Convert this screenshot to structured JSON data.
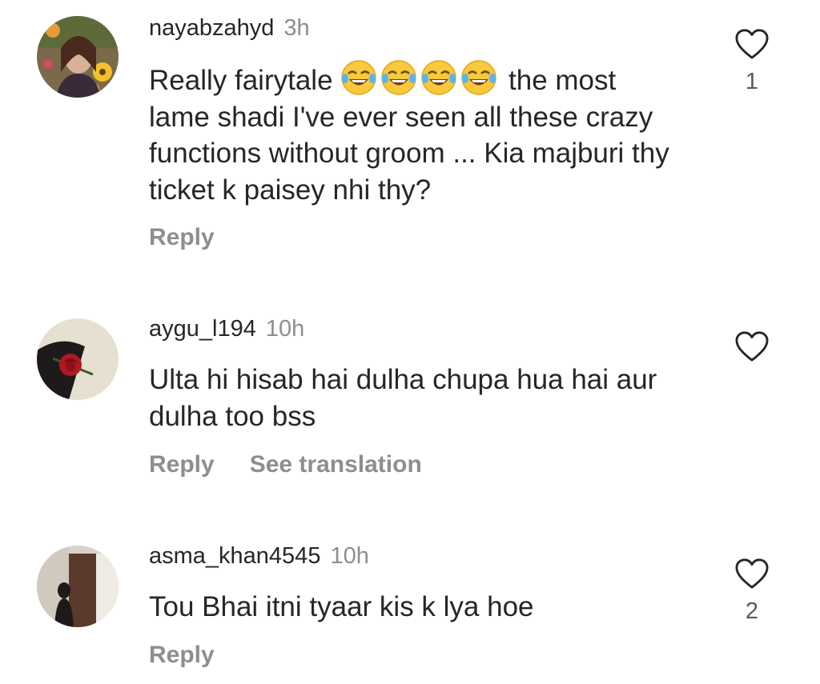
{
  "comments": [
    {
      "username": "nayabzahyd",
      "time": "3h",
      "text_before": "Really fairytale",
      "emoji": [
        "😂",
        "😂",
        "😂",
        "😂"
      ],
      "text_after": "the most lame shadi I've ever seen all these crazy functions without groom ... Kia majburi thy ticket k paisey nhi thy?",
      "reply_label": "Reply",
      "like_count": "1"
    },
    {
      "username": "aygu_l194",
      "time": "10h",
      "text": "Ulta hi hisab hai dulha chupa hua hai aur dulha too bss",
      "reply_label": "Reply",
      "translate_label": "See translation",
      "like_count": ""
    },
    {
      "username": "asma_khan4545",
      "time": "10h",
      "text": "Tou Bhai itni tyaar kis k lya hoe",
      "reply_label": "Reply",
      "like_count": "2"
    }
  ],
  "colors": {
    "primary_text": "#262626",
    "secondary_text": "#8e8e8e",
    "heart_outline": "#262626"
  }
}
